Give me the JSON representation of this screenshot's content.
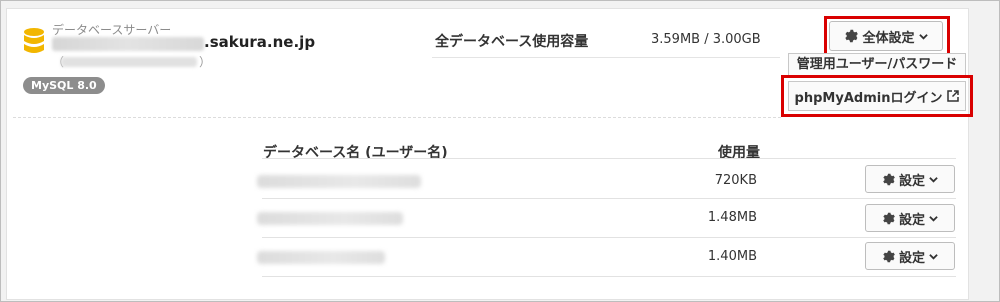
{
  "server": {
    "type_label": "データベースサーバー",
    "host_domain": ".sakura.ne.jp",
    "paren_open": "（",
    "paren_close": "）",
    "badge": "MySQL 8.0"
  },
  "capacity": {
    "label": "全データベース使用容量",
    "value": "3.59MB / 3.00GB"
  },
  "global_settings": {
    "label": "全体設定",
    "menu": [
      "管理用ユーザー/パスワード",
      "phpMyAdminログイン"
    ]
  },
  "table": {
    "headers": {
      "name": "データベース名 (ユーザー名)",
      "usage": "使用量"
    },
    "rows": [
      {
        "usage": "720KB",
        "button": "設定"
      },
      {
        "usage": "1.48MB",
        "button": "設定"
      },
      {
        "usage": "1.40MB",
        "button": "設定"
      }
    ]
  },
  "colors": {
    "highlight": "#d90000",
    "db_icon": "#f2b600",
    "badge_bg": "#8d8d8d"
  },
  "icons": {
    "database": "database-icon",
    "gear": "gear-icon",
    "chevron": "chevron-down-icon",
    "external": "external-link-icon"
  }
}
